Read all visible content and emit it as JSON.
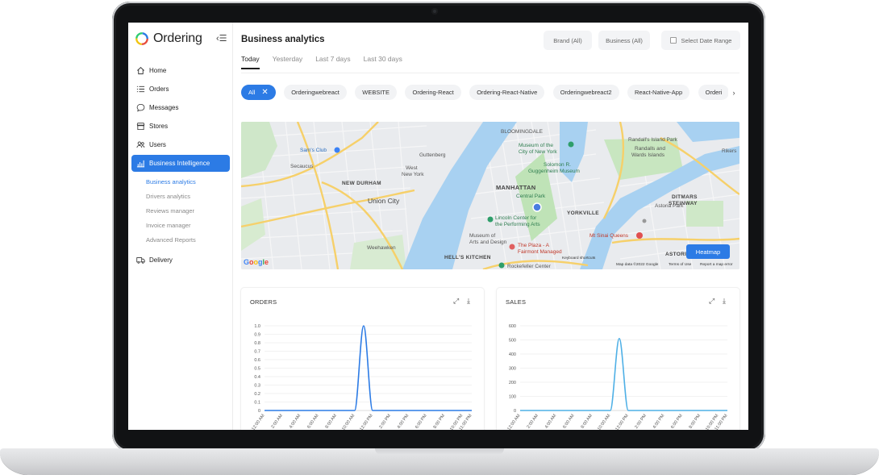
{
  "sidebar": {
    "brand": "Ordering",
    "collapse": "‹☰",
    "items": [
      {
        "label": "Home",
        "icon": "home-icon"
      },
      {
        "label": "Orders",
        "icon": "list-icon"
      },
      {
        "label": "Messages",
        "icon": "chat-icon"
      },
      {
        "label": "Stores",
        "icon": "store-icon"
      },
      {
        "label": "Users",
        "icon": "users-icon"
      },
      {
        "label": "Business Intelligence",
        "icon": "bar-chart-icon"
      }
    ],
    "submenu": [
      "Business analytics",
      "Drivers analytics",
      "Reviews manager",
      "Invoice manager",
      "Advanced Reports"
    ],
    "delivery": {
      "label": "Delivery",
      "icon": "truck-icon"
    }
  },
  "header": {
    "title": "Business analytics",
    "brand_filter": "Brand (All)",
    "business_filter": "Business (All)",
    "date_range": "Select Date Range"
  },
  "tabs": [
    "Today",
    "Yesterday",
    "Last 7 days",
    "Last 30 days"
  ],
  "chips": [
    "All",
    "Orderingwebreact",
    "WEBSITE",
    "Ordering-React",
    "Ordering-React-Native",
    "Orderingwebreact2",
    "React-Native-App",
    "Orderi"
  ],
  "map": {
    "labels": {
      "bloomingdale": "BLOOMINGDALE",
      "museum_nyc_1": "Museum of the",
      "museum_nyc_2": "City of New York",
      "randalls_1": "Randall's Island Park",
      "randalls_2": "Randalls and",
      "randalls_3": "Wards Islands",
      "rikers": "Rikers",
      "sams_club": "Sam's Club",
      "secaucus": "Secaucus",
      "guttenberg": "Guttenberg",
      "west_ny_1": "West",
      "west_ny_2": "New York",
      "guggenheim_1": "Solomon R.",
      "guggenheim_2": "Guggenheim Museum",
      "new_durham": "NEW DURHAM",
      "manhattan": "MANHATTAN",
      "central_park": "Central Park",
      "union_city": "Union City",
      "yorkville": "YORKVILLE",
      "ditmars_1": "DITMARS",
      "ditmars_2": "STEINWAY",
      "astoria_park": "Astoria Park",
      "lincoln_1": "Lincoln Center for",
      "lincoln_2": "the Performing Arts",
      "mt_sinai": "Mt Sinai Queens",
      "museum_arts_1": "Museum of",
      "museum_arts_2": "Arts and Design",
      "plaza_1": "The Plaza - A",
      "plaza_2": "Fairmont Managed",
      "weehawken": "Weehawken",
      "hells_kitchen": "HELL'S KITCHEN",
      "rockefeller": "Rockefeller Center",
      "astoria": "ASTORIA"
    },
    "heatmap_button": "Heatmap",
    "google": "Google",
    "footer_keyboard": "Keyboard shortcuts",
    "footer_data": "Map data ©2022 Google",
    "footer_terms": "Terms of Use",
    "footer_report": "Report a map error"
  },
  "chart_data": [
    {
      "type": "line",
      "title": "ORDERS",
      "color": "#2c7be5",
      "ylim": [
        0,
        1.0
      ],
      "yticks": [
        "0",
        "0.1",
        "0.2",
        "0.3",
        "0.4",
        "0.5",
        "0.6",
        "0.7",
        "0.8",
        "0.9",
        "1.0"
      ],
      "categories": [
        "12:00 AM",
        "1:00 AM",
        "2:00 AM",
        "3:00 AM",
        "4:00 AM",
        "5:00 AM",
        "6:00 AM",
        "7:00 AM",
        "8:00 AM",
        "9:00 AM",
        "10:00 AM",
        "11:00 AM",
        "12:00 PM",
        "1:00 PM",
        "2:00 PM",
        "3:00 PM",
        "4:00 PM",
        "5:00 PM",
        "6:00 PM",
        "7:00 PM",
        "8:00 PM",
        "9:00 PM",
        "10:00 PM",
        "11:00 PM"
      ],
      "values": [
        0,
        0,
        0,
        0,
        0,
        0,
        0,
        0,
        0,
        0,
        0,
        1,
        0,
        0,
        0,
        0,
        0,
        0,
        0,
        0,
        0,
        0,
        0,
        0
      ]
    },
    {
      "type": "line",
      "title": "SALES",
      "color": "#4fb0e6",
      "ylim": [
        0,
        600
      ],
      "yticks": [
        "0",
        "100",
        "200",
        "300",
        "400",
        "500",
        "600"
      ],
      "categories": [
        "12:00 AM",
        "1:00 AM",
        "2:00 AM",
        "3:00 AM",
        "4:00 AM",
        "5:00 AM",
        "6:00 AM",
        "7:00 AM",
        "8:00 AM",
        "9:00 AM",
        "10:00 AM",
        "11:00 AM",
        "12:00 PM",
        "1:00 PM",
        "2:00 PM",
        "3:00 PM",
        "4:00 PM",
        "5:00 PM",
        "6:00 PM",
        "7:00 PM",
        "8:00 PM",
        "9:00 PM",
        "10:00 PM",
        "11:00 PM"
      ],
      "values": [
        0,
        0,
        0,
        0,
        0,
        0,
        0,
        0,
        0,
        0,
        0,
        510,
        0,
        0,
        0,
        0,
        0,
        0,
        0,
        0,
        0,
        0,
        0,
        0
      ]
    }
  ],
  "colors": {
    "accent": "#2c7be5",
    "sales_line": "#4fb0e6"
  }
}
